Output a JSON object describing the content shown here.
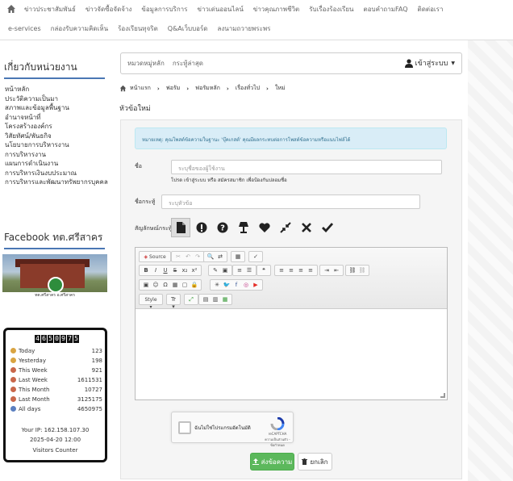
{
  "nav": {
    "row1": [
      "ข่าวประชาสัมพันธ์",
      "ข่าวจัดซื้อจัดจ้าง",
      "ข้อมูลการบริการ",
      "ข่าวเด่นออนไลน์",
      "ข่าวคุณภาพชีวิต",
      "รับเรื่องร้องเรียน",
      "ตอบคำถามFAQ",
      "ติดต่อเรา"
    ],
    "row2": [
      "e-services",
      "กล่องรับความคิดเห็น",
      "ร้องเรียนทุจริต",
      "Q&Aเว็บบอร์ด",
      "ลงนามถวายพระพร"
    ]
  },
  "sidebar": {
    "title": "เกี่ยวกับหน่วยงาน",
    "items": [
      "หน้าหลัก",
      "ประวัติความเป็นมา",
      "สภาพและข้อมูลพื้นฐาน",
      "อำนาจหน้าที่",
      "โครงสร้างองค์กร",
      "วิสัยทัศน์/พันธกิจ",
      "นโยบายการบริหารงาน",
      "การบริหารงาน",
      "แผนการดำเนินงาน",
      "การบริหารเงินงบประมาณ",
      "การบริหารและพัฒนาทรัพยากรบุคคล"
    ],
    "fb_title": "Facebook ทต.ศรีสาคร",
    "fb_caption": "ทต.ศรีสาคร อ.ศรีสาคร"
  },
  "counter": {
    "digits": "4650975",
    "rows": [
      {
        "label": "Today",
        "value": "123",
        "color": "#d9a441"
      },
      {
        "label": "Yesterday",
        "value": "198",
        "color": "#d9a441"
      },
      {
        "label": "This Week",
        "value": "921",
        "color": "#c9674a"
      },
      {
        "label": "Last Week",
        "value": "1611531",
        "color": "#c9674a"
      },
      {
        "label": "This Month",
        "value": "10727",
        "color": "#c9674a"
      },
      {
        "label": "Last Month",
        "value": "3125175",
        "color": "#c9674a"
      },
      {
        "label": "All days",
        "value": "4650975",
        "color": "#5b7fc0"
      }
    ],
    "ip": "Your IP: 162.158.107.30",
    "datetime": "2025-04-20 12:00",
    "footer": "Visitors Counter"
  },
  "topbar": {
    "cat_label": "หมวดหมู่หลัก",
    "search_label": "กระทู้ล่าสุด",
    "login_label": "เข้าสู่ระบบ"
  },
  "breadcrumb": [
    "หน้าแรก",
    "ฟอรัม",
    "ฟอรัมหลัก",
    "เรื่องทั่วไป",
    "ใหม่"
  ],
  "page_title": "หัวข้อใหม่",
  "form": {
    "alert": "หมายเหตุ: คุณโพสต์ข้อความในฐานะ 'บุ๊คเกสต์' คุณมีผลกระทบต่อการโพสต์ข้อความหรือแนบไฟล์ได้",
    "name_label": "ชื่อ",
    "name_placeholder": "ระบุชื่อของผู้ใช้งาน",
    "name_hint": "โปรด เข้าสู่ระบบ หรือ สมัครสมาชิก เพื่อป้องกันปลอมชื่อ",
    "subject_label": "ชื่อกระทู้",
    "subject_placeholder": "ระบุหัวข้อ",
    "icon_label": "สัญลักษณ์กระทู้",
    "source_label": "Source",
    "style_label": "Style",
    "captcha_text": "ฉันไม่ใช่โปรแกรมอัตโนมัติ",
    "captcha_brand": "reCAPTCHA",
    "captcha_terms": "ความเป็นส่วนตัว - ข้อกำหนด",
    "submit_label": "ส่งข้อความ",
    "cancel_label": "ยกเลิก"
  }
}
